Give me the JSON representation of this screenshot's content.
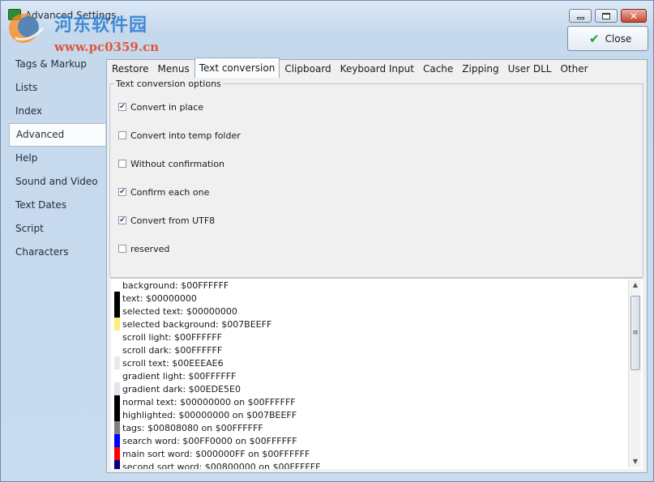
{
  "window": {
    "title": "Advanced Settings",
    "watermark_line1": "河东软件园",
    "watermark_line2": "www.pc0359.cn",
    "close_label": "Close"
  },
  "nav": {
    "items": [
      "Tags & Markup",
      "Lists",
      "Index",
      "Advanced",
      "Help",
      "Sound and Video",
      "Text Dates",
      "Script",
      "Characters"
    ],
    "active": "Advanced"
  },
  "tabs": {
    "items": [
      "Restore",
      "Menus",
      "Text conversion",
      "Clipboard",
      "Keyboard Input",
      "Cache",
      "Zipping",
      "User DLL",
      "Other"
    ],
    "active": "Text conversion"
  },
  "group": {
    "title": "Text conversion options",
    "options": [
      {
        "label": "Convert in place",
        "checked": true
      },
      {
        "label": "Convert into temp folder",
        "checked": false
      },
      {
        "label": "Without confirmation",
        "checked": false
      },
      {
        "label": "Confirm each one",
        "checked": true
      },
      {
        "label": "Convert from UTF8",
        "checked": true
      },
      {
        "label": "reserved",
        "checked": false
      }
    ]
  },
  "colors": [
    {
      "text": "background: $00FFFFFF",
      "swatch": "#FFFFFF"
    },
    {
      "text": "text: $00000000",
      "swatch": "#000000"
    },
    {
      "text": "selected text: $00000000",
      "swatch": "#000000"
    },
    {
      "text": "selected background: $007BEEFF",
      "swatch": "#FFEE7B"
    },
    {
      "text": "scroll light: $00FFFFFF",
      "swatch": "#FFFFFF"
    },
    {
      "text": "scroll dark: $00FFFFFF",
      "swatch": "#FFFFFF"
    },
    {
      "text": "scroll text: $00EEEAE6",
      "swatch": "#E6EAEE"
    },
    {
      "text": "gradient light: $00FFFFFF",
      "swatch": "#FFFFFF"
    },
    {
      "text": "gradient dark: $00EDE5E0",
      "swatch": "#E0E5ED"
    },
    {
      "text": "normal text: $00000000 on $00FFFFFF",
      "swatch": "#000000"
    },
    {
      "text": "highlighted: $00000000 on $007BEEFF",
      "swatch": "#000000"
    },
    {
      "text": "tags: $00808080 on $00FFFFFF",
      "swatch": "#808080"
    },
    {
      "text": "search word: $00FF0000 on $00FFFFFF",
      "swatch": "#0000FF"
    },
    {
      "text": "main sort word: $000000FF on $00FFFFFF",
      "swatch": "#FF0000"
    },
    {
      "text": "second sort word: $00800000 on $00FFFFFF",
      "swatch": "#000080"
    }
  ]
}
